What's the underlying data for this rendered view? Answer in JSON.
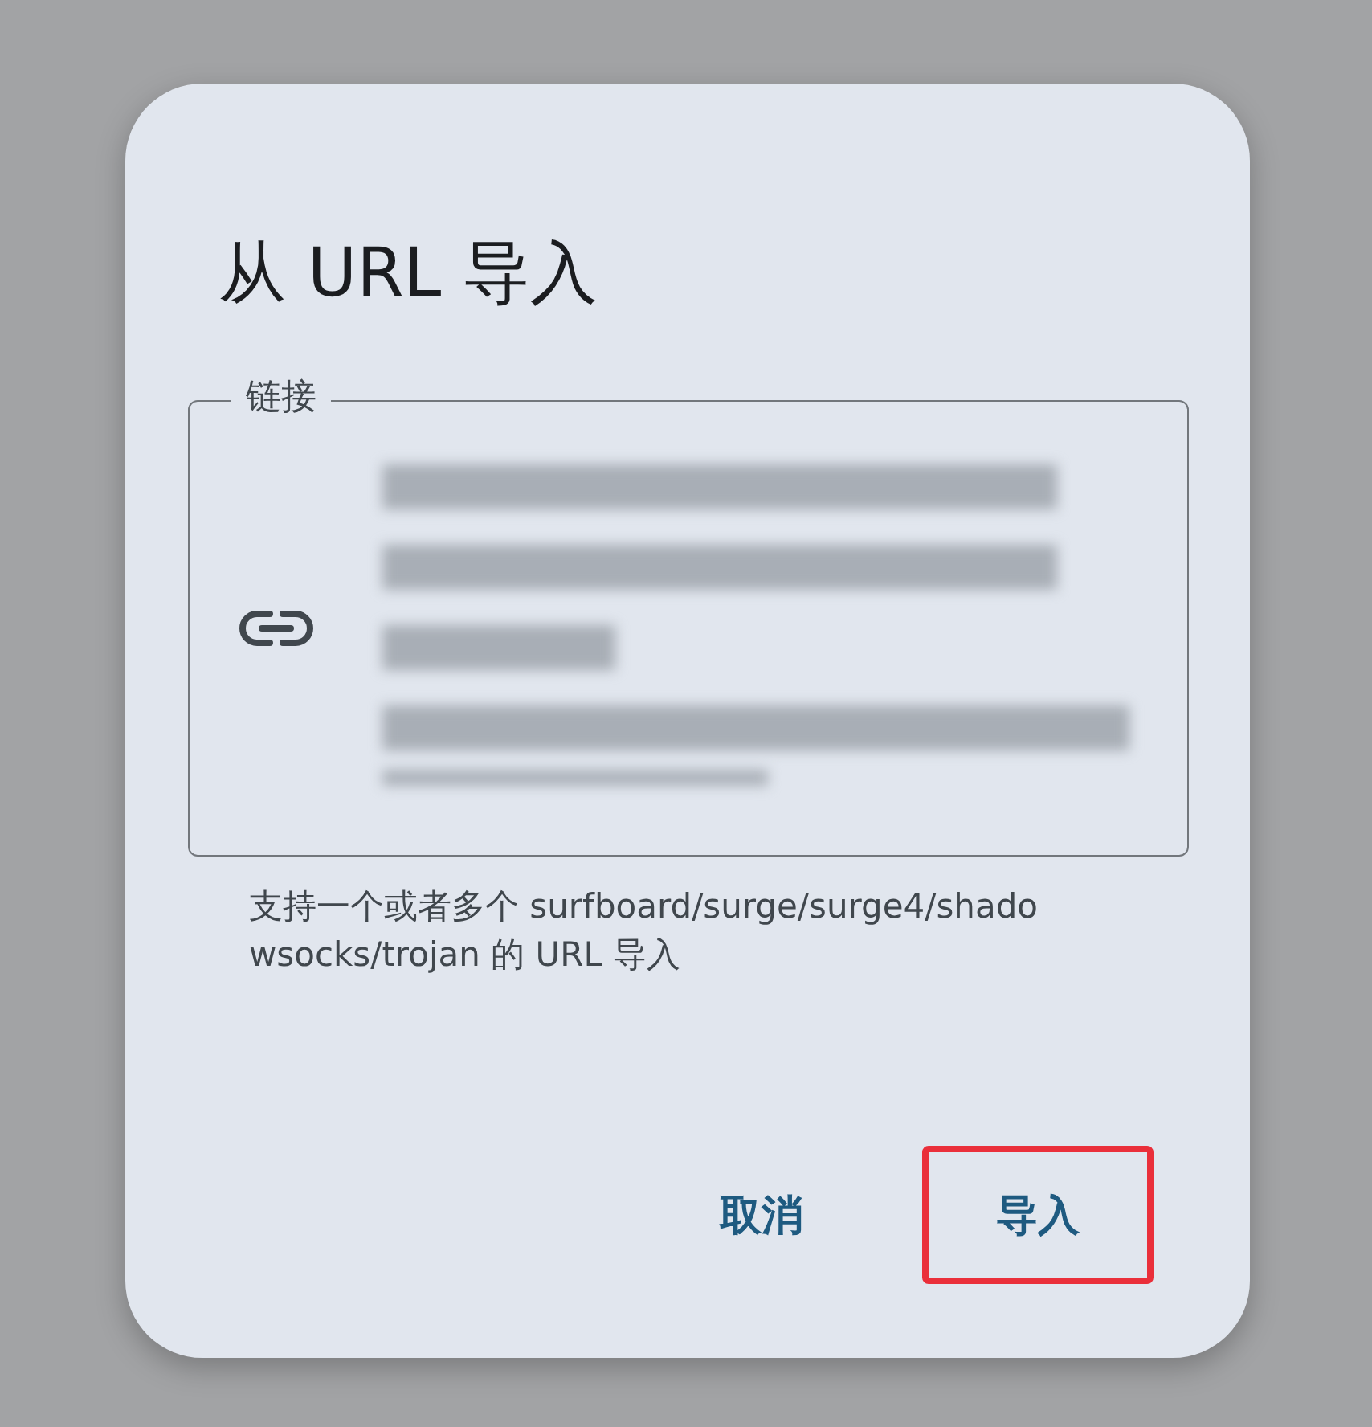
{
  "dialog": {
    "title": "从 URL 导入",
    "field": {
      "label": "链接"
    },
    "helper": "支持一个或者多个 surfboard/surge/surge4/shadowsocks/trojan 的 URL 导入",
    "buttons": [
      {
        "label": "取消",
        "highlighted": false
      },
      {
        "label": "导入",
        "highlighted": true
      }
    ]
  }
}
